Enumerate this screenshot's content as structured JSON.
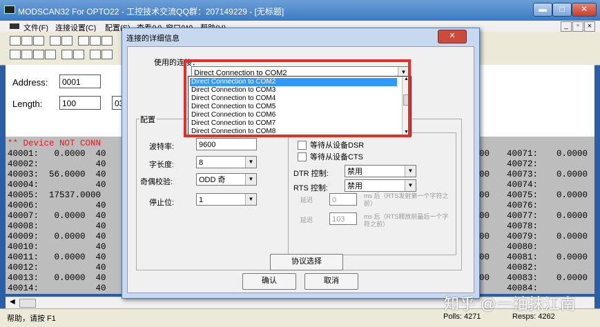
{
  "window": {
    "title": "MODSCAN32 For OPTO22 - 工控技术交流QQ群：207149229 - [无标题]",
    "min": "▬",
    "max": "□",
    "close": "✕",
    "child_min": "_",
    "child_max": "▫",
    "child_close": "×"
  },
  "menu": [
    "文件(F)",
    "连接设置(C)",
    "配置(S)",
    "查看(V)",
    "窗口(W)",
    "帮助(H)"
  ],
  "params": {
    "address_label": "Address:",
    "address_value": "0001",
    "length_label": "Length:",
    "length_value": "100",
    "device_prefix": "03"
  },
  "grid": {
    "banner": "** Device NOT CONN",
    "rows": [
      {
        "l": "40001:   0.0000  40",
        "r1": "00",
        "r2": "40071:",
        "r3": "0.0000"
      },
      {
        "l": "40002:           40",
        "r1": "",
        "r2": "40072:",
        "r3": ""
      },
      {
        "l": "40003:  56.0000  40",
        "r1": "00",
        "r2": "40073:",
        "r3": "0.0000"
      },
      {
        "l": "40004:           40",
        "r1": "",
        "r2": "40074:",
        "r3": ""
      },
      {
        "l": "40005:  17537.0000",
        "r1": "00",
        "r2": "40075:",
        "r3": "0.0000"
      },
      {
        "l": "40006:           40",
        "r1": "",
        "r2": "40076:",
        "r3": ""
      },
      {
        "l": "40007:   0.0000  40",
        "r1": "00",
        "r2": "40077:",
        "r3": "0.0000"
      },
      {
        "l": "40008:           40",
        "r1": "",
        "r2": "40078:",
        "r3": ""
      },
      {
        "l": "40009:   0.0000  40",
        "r1": "00",
        "r2": "40079:",
        "r3": "0.0000"
      },
      {
        "l": "40010:           40",
        "r1": "",
        "r2": "40080:",
        "r3": ""
      },
      {
        "l": "40011:   0.0000  40",
        "r1": "00",
        "r2": "40081:",
        "r3": "0.0000"
      },
      {
        "l": "40012:           40",
        "r1": "",
        "r2": "40082:",
        "r3": ""
      },
      {
        "l": "40013:   0.0000  40",
        "r1": "00",
        "r2": "40083:",
        "r3": "0.0000"
      },
      {
        "l": "40014:           40",
        "r1": "",
        "r2": "40084:",
        "r3": ""
      }
    ]
  },
  "status": {
    "help": "帮助，请按 F1",
    "polls": "Polls: 4271",
    "resps": "Resps: 4262"
  },
  "dialog": {
    "title": "连接的详细信息",
    "connection_label": "使用的连接：",
    "connection_value": "Direct Connection to COM2",
    "dropdown_items": [
      "Direct Connection to COM2",
      "Direct Connection to COM3",
      "Direct Connection to COM4",
      "Direct Connection to COM5",
      "Direct Connection to COM6",
      "Direct Connection to COM7",
      "Direct Connection to COM8"
    ],
    "config_group": "配置",
    "baud_label": "波特率:",
    "baud_value": "9600",
    "wordlen_label": "字长度:",
    "wordlen_value": "8",
    "parity_label": "奇偶校验:",
    "parity_value": "ODD 奇",
    "stopbits_label": "停止位:",
    "stopbits_value": "1",
    "wait_dsr": "等待从设备DSR",
    "wait_cts": "等待从设备CTS",
    "dtr_label": "DTR 控制:",
    "dtr_value": "禁用",
    "rts_label": "RTS 控制:",
    "rts_value": "禁用",
    "delay1_label": "延迟",
    "delay1_value": "0",
    "delay1_note": "ms 后（RTS发射第一个字符之前）",
    "delay2_label": "延迟",
    "delay2_value": "103",
    "delay2_note": "ms 后（RTS释放前最后一个字符之前）",
    "protocol_btn": "协议选择",
    "ok_btn": "确认",
    "cancel_btn": "取消"
  },
  "watermark": "知乎 @一袖抹江南"
}
